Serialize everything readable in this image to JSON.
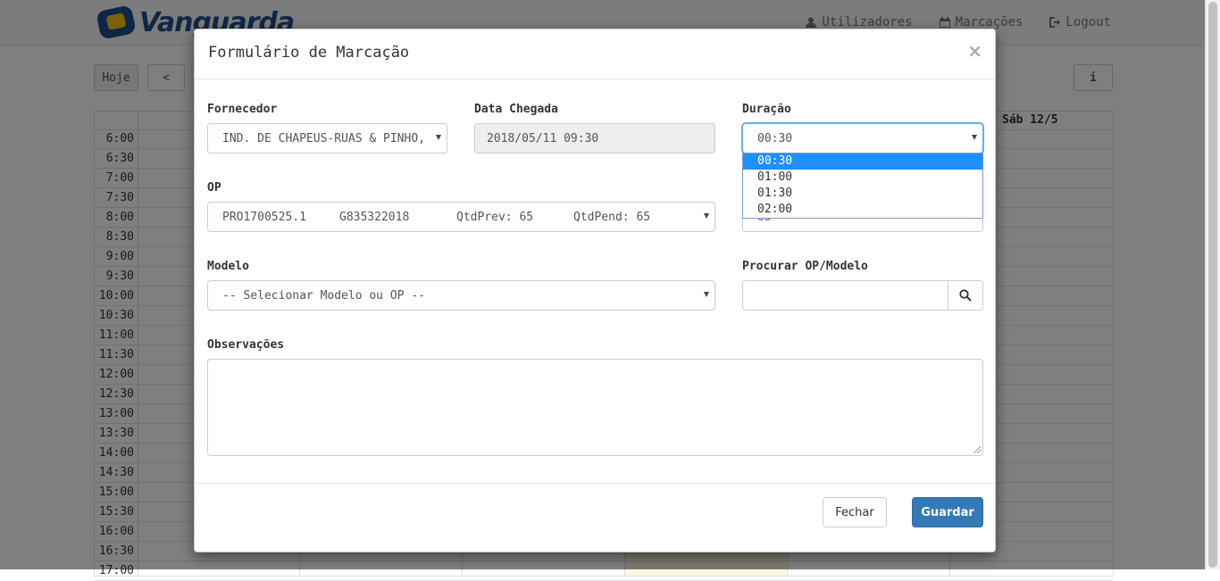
{
  "navbar": {
    "brand": "Vanguarda",
    "links": [
      {
        "label": "Utilizadores",
        "icon": "user-icon"
      },
      {
        "label": "Marcações",
        "icon": "calendar-icon"
      },
      {
        "label": "Logout",
        "icon": "logout-icon"
      }
    ]
  },
  "toolbar": {
    "today_label": "Hoje",
    "prev_label": "<",
    "info_label": "i"
  },
  "calendar": {
    "visible_day": "Sáb 12/5",
    "times": [
      "6:00",
      "6:30",
      "7:00",
      "7:30",
      "8:00",
      "8:30",
      "9:00",
      "9:30",
      "10:00",
      "10:30",
      "11:00",
      "11:30",
      "12:00",
      "12:30",
      "13:00",
      "13:30",
      "14:00",
      "14:30",
      "15:00",
      "15:30",
      "16:00",
      "16:30",
      "17:00"
    ]
  },
  "modal": {
    "title": "Formulário de Marcação",
    "close_label": "×",
    "fornecedor": {
      "label": "Fornecedor",
      "value": "IND. DE CHAPEUS-RUAS & PINHO, LDA"
    },
    "data_chegada": {
      "label": "Data Chegada",
      "value": "2018/05/11 09:30"
    },
    "duracao": {
      "label": "Duração",
      "value": "00:30",
      "options": [
        "00:30",
        "01:00",
        "01:30",
        "02:00"
      ]
    },
    "op": {
      "label": "OP",
      "code": "PRO1700525.1",
      "ref": "G835322018",
      "qtd_prev": "QtdPrev: 65",
      "qtd_pend": "QtdPend: 65"
    },
    "hidden_field_value": "65",
    "modelo": {
      "label": "Modelo",
      "placeholder": "-- Selecionar Modelo ou OP --"
    },
    "procurar": {
      "label": "Procurar OP/Modelo",
      "value": ""
    },
    "observacoes": {
      "label": "Observações",
      "value": ""
    },
    "buttons": {
      "close": "Fechar",
      "save": "Guardar"
    }
  }
}
